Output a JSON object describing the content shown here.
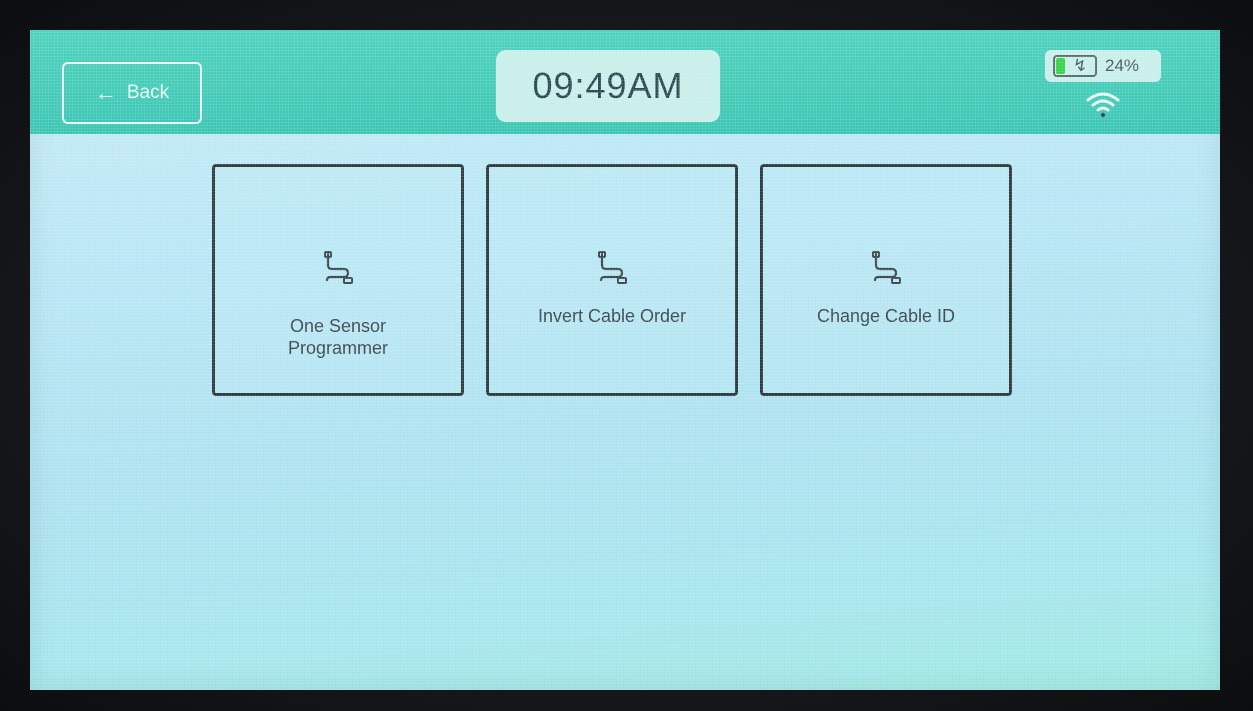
{
  "header": {
    "back_label": "Back",
    "time": "09:49AM",
    "battery_percent_label": "24%",
    "battery_level": 0.24,
    "color": "#3cc6b3"
  },
  "icons": {
    "back": "arrow-left-icon",
    "battery": "battery-charging-icon",
    "wifi": "wifi-icon",
    "tile": "cable-icon"
  },
  "tiles": [
    {
      "label": "One Sensor Programmer"
    },
    {
      "label": "Invert Cable Order"
    },
    {
      "label": "Change Cable ID"
    }
  ],
  "colors": {
    "screen_background": "#b8e6f4",
    "battery_fill": "#38d247",
    "tile_border": "#2d3a3e"
  }
}
